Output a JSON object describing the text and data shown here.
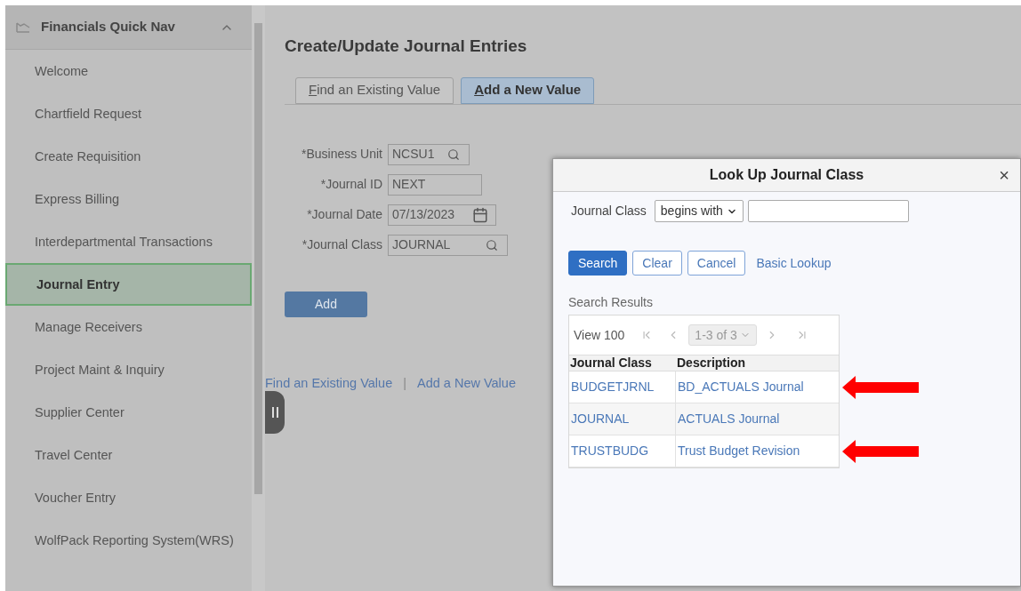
{
  "sidebar": {
    "title": "Financials Quick Nav",
    "expanded": true,
    "items": [
      {
        "label": "Welcome",
        "selected": false
      },
      {
        "label": "Chartfield Request",
        "selected": false
      },
      {
        "label": "Create Requisition",
        "selected": false
      },
      {
        "label": "Express Billing",
        "selected": false
      },
      {
        "label": "Interdepartmental Transactions",
        "selected": false
      },
      {
        "label": "Journal Entry",
        "selected": true
      },
      {
        "label": "Manage Receivers",
        "selected": false
      },
      {
        "label": "Project Maint & Inquiry",
        "selected": false
      },
      {
        "label": "Supplier Center",
        "selected": false
      },
      {
        "label": "Travel Center",
        "selected": false
      },
      {
        "label": "Voucher Entry",
        "selected": false
      },
      {
        "label": "WolfPack Reporting System(WRS)",
        "selected": false
      }
    ]
  },
  "page": {
    "title": "Create/Update Journal Entries",
    "tabs": [
      {
        "label": "Find an Existing Value",
        "selected": false
      },
      {
        "label": "Add a New Value",
        "selected": true
      }
    ],
    "fields": [
      {
        "label": "*Business Unit",
        "value": "NCSU1",
        "kind": "lookup"
      },
      {
        "label": "*Journal ID",
        "value": "NEXT",
        "kind": "text"
      },
      {
        "label": "*Journal Date",
        "value": "07/13/2023",
        "kind": "date"
      },
      {
        "label": "*Journal Class",
        "value": "JOURNAL",
        "kind": "lookup"
      }
    ],
    "add_button": "Add",
    "links": [
      "Find an Existing Value",
      "Add a New Value"
    ],
    "separator": "|"
  },
  "dialog": {
    "title": "Look Up Journal Class",
    "close": "×",
    "filter": {
      "label": "Journal Class",
      "operator": "begins with"
    },
    "buttons": [
      {
        "label": "Search",
        "kind": "primary"
      },
      {
        "label": "Clear",
        "kind": "secondary"
      },
      {
        "label": "Cancel",
        "kind": "secondary"
      }
    ],
    "basic_lookup": "Basic Lookup",
    "results": {
      "title": "Search Results",
      "view": "View 100",
      "range": "1-3 of 3",
      "columns": [
        "Journal Class",
        "Description"
      ],
      "rows": [
        {
          "cells": [
            "BUDGETJRNL",
            "BD_ACTUALS Journal"
          ],
          "arrow": true
        },
        {
          "cells": [
            "JOURNAL",
            "ACTUALS Journal"
          ],
          "arrow": false
        },
        {
          "cells": [
            "TRUSTBUDG",
            "Trust Budget Revision"
          ],
          "arrow": true
        }
      ]
    }
  }
}
